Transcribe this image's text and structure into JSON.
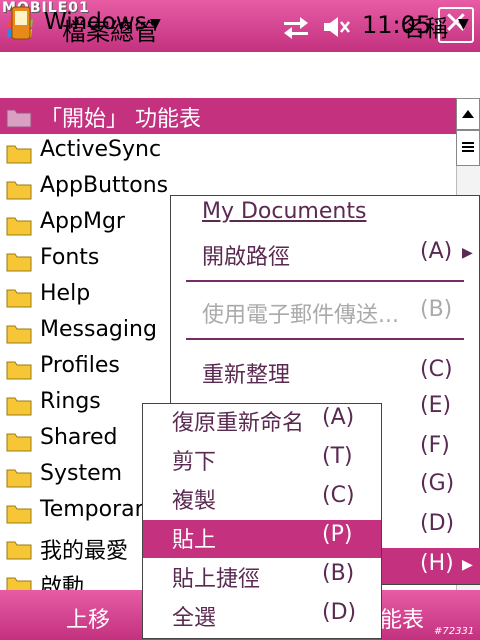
{
  "titlebar": {
    "watermark": "MOBILE01",
    "title": "檔案總管",
    "clock": "11:05",
    "close_label": "✕",
    "icons": [
      "windows-flag-icon",
      "sync-arrows-icon",
      "speaker-icon",
      "close-icon"
    ]
  },
  "addressbar": {
    "folder": "Windows",
    "sort_by": "名稱"
  },
  "files": [
    {
      "name": "「開始」 功能表",
      "selected": true
    },
    {
      "name": "ActiveSync"
    },
    {
      "name": "AppButtons"
    },
    {
      "name": "AppMgr"
    },
    {
      "name": "Fonts"
    },
    {
      "name": "Help"
    },
    {
      "name": "Messaging"
    },
    {
      "name": "Profiles"
    },
    {
      "name": "Rings"
    },
    {
      "name": "Shared"
    },
    {
      "name": "System"
    },
    {
      "name": "Temporar"
    },
    {
      "name": "我的最愛"
    },
    {
      "name": "啟動"
    }
  ],
  "menu1": {
    "my_documents": "My Documents",
    "open_path": "開啟路徑",
    "open_path_key": "(A)",
    "send_email": "使用電子郵件傳送...",
    "send_email_key": "(B)",
    "refresh": "重新整理",
    "refresh_key": "(C)",
    "item_e_key": "(E)",
    "item_f_key": "(F)",
    "item_g_key": "(G)",
    "item_d_key": "(D)",
    "item_h_key": "(H)"
  },
  "menu2": {
    "items": [
      {
        "label": "復原重新命名",
        "key": "(A)"
      },
      {
        "label": "剪下",
        "key": "(T)"
      },
      {
        "label": "複製",
        "key": "(C)"
      },
      {
        "label": "貼上",
        "key": "(P)",
        "selected": true
      },
      {
        "label": "貼上捷徑",
        "key": "(B)"
      },
      {
        "label": "全選",
        "key": "(D)"
      }
    ]
  },
  "softkeys": {
    "left": "上移",
    "right": "能表"
  },
  "footer_tag": "#72331",
  "colors": {
    "accent": "#c3317f",
    "accent_light": "#e75ca5",
    "menu_text": "#5a2a52"
  }
}
